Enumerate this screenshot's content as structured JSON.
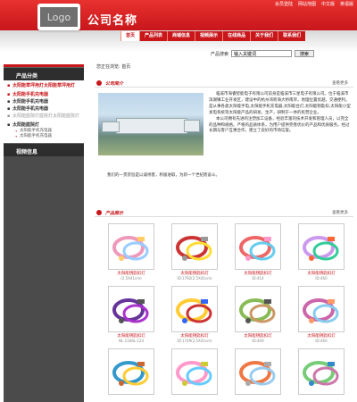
{
  "header": {
    "logo_text": "Logo",
    "company_name": "公司名称",
    "top_links": [
      "会员登陆",
      "网站地图",
      "中文版",
      "英语版"
    ]
  },
  "nav": {
    "items": [
      "首页",
      "产品列表",
      "商铺信息",
      "视频展示",
      "在线商品",
      "关于我们",
      "联系我们"
    ],
    "active_index": 0
  },
  "search": {
    "label": "产品搜索",
    "placeholder": "输入关键词",
    "value": "输入关键词",
    "button": "搜索"
  },
  "breadcrumb": "您正在浏览: 首页",
  "sidebar": {
    "category_title": "产品分类",
    "categories": [
      {
        "label": "太阳能草坪用灯太阳能草坪用灯",
        "style": "red",
        "subs": []
      },
      {
        "label": "太阳能手机充电器",
        "style": "red",
        "subs": []
      },
      {
        "label": "太阳能手机充电器",
        "style": "dark",
        "subs": []
      },
      {
        "label": "太阳能手机充电器",
        "style": "dark",
        "subs": []
      },
      {
        "label": "太阳能庭院灯庭院灯太阳能庭院灯",
        "style": "muted",
        "subs": []
      },
      {
        "label": "太阳能庭院灯",
        "style": "dark",
        "subs": [
          "太阳能手机充电器",
          "太阳能手机充电器"
        ]
      }
    ],
    "video_title": "视频信息"
  },
  "intro": {
    "title": "公司简介",
    "more": "查看更多",
    "paragraph1": "临溪市海睿智能电子有限公司前身是临溪市三星电子有限公司。位于临溪市滨湖镇工业开发区，建设中的杭州湾跨海大桥南岸，地理位置优越，交通便利。是从事各类太阳能手电,太阳能手机充电器,太阳能台灯,太阳能钥匙扣,太阳能小型发电系统等太阳能产品的研发，生产，研制于一体的民营企业。",
    "paragraph2": "本公司拥有先进的注塑加工设备，经验丰富的技术开发和管理人员，以完全的品种和规格。严格的品质体系，为用户提供完善优价的产品和优质服务。经过长期与客户互惠合作，建立了良好的市场信誉。",
    "tail": "我们的一贯宗旨是以诚待客，积极进取，为新一个世纪而奋斗。"
  },
  "products_section": {
    "title": "产品展示",
    "more": "查看更多",
    "items": [
      {
        "name": "太阳能钥匙扣灯",
        "sub": "(2.5X41cm)"
      },
      {
        "name": "太阳能钥匙扣灯",
        "sub": "ID:1792(2.5X41cm)"
      },
      {
        "name": "太阳能钥匙扣灯",
        "sub": "ID:414"
      },
      {
        "name": "太阳能钥匙扣灯",
        "sub": "ID:460"
      },
      {
        "name": "太阳能钥匙扣灯",
        "sub": "NL-1348L-124"
      },
      {
        "name": "太阳能钥匙扣灯",
        "sub": "ID:1749(2.5X41cm)"
      },
      {
        "name": "太阳能钥匙扣灯",
        "sub": "ID:409"
      },
      {
        "name": "太阳能钥匙扣灯",
        "sub": "ID:460"
      },
      {
        "name": "",
        "sub": ""
      },
      {
        "name": "",
        "sub": ""
      },
      {
        "name": "",
        "sub": ""
      },
      {
        "name": "",
        "sub": ""
      }
    ]
  },
  "colors": {
    "brand_red": "#c8161b",
    "sidebar_dark": "#4b4b4b"
  }
}
